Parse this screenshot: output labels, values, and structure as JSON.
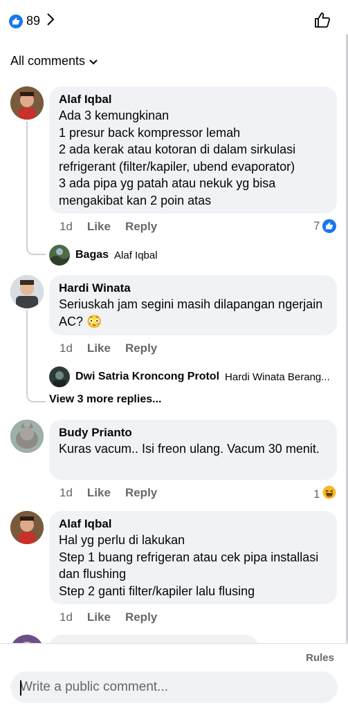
{
  "header": {
    "reaction_count": "89",
    "sort_label": "All comments"
  },
  "comments": [
    {
      "author": "Alaf Iqbal",
      "text": "Ada 3 kemungkinan\n1 presur back kompressor lemah\n2 ada kerak atau kotoran di dalam sirkulasi refrigerant (filter/kapiler, ubend evaporator)\n3 ada pipa yg patah atau nekuk yg bisa mengakibat kan 2 poin atas",
      "time": "1d",
      "like_label": "Like",
      "reply_label": "Reply",
      "reactions": "7",
      "reaction_icon": "like"
    },
    {
      "author": "Hardi Winata",
      "text": "Seriuskah jam segini masih dilapangan ngerjain AC? 😳",
      "time": "1d",
      "like_label": "Like",
      "reply_label": "Reply"
    },
    {
      "author": "Budy Prianto",
      "text": "Kuras vacum.. Isi freon ulang. Vacum 30 menit.",
      "time": "1d",
      "like_label": "Like",
      "reply_label": "Reply",
      "reactions": "1",
      "reaction_icon": "haha"
    },
    {
      "author": "Alaf Iqbal",
      "text": "Hal yg perlu di lakukan\nStep 1 buang refrigeran atau cek pipa installasi dan flushing\nStep 2 ganti filter/kapiler lalu flusing",
      "time": "1d",
      "like_label": "Like",
      "reply_label": "Reply"
    }
  ],
  "replies": [
    {
      "author": "Bagas",
      "tag": "Alaf Iqbal"
    },
    {
      "author": "Dwi Satria Kroncong Protol",
      "tag": "Hardi Winata  Berang..."
    }
  ],
  "more_replies_label": "View 3 more replies...",
  "footer": {
    "rules_label": "Rules",
    "composer_placeholder": "Write a public comment..."
  },
  "colors": {
    "brand_blue": "#1877f2",
    "bubble_bg": "#f0f2f5",
    "meta_gray": "#65676b"
  }
}
